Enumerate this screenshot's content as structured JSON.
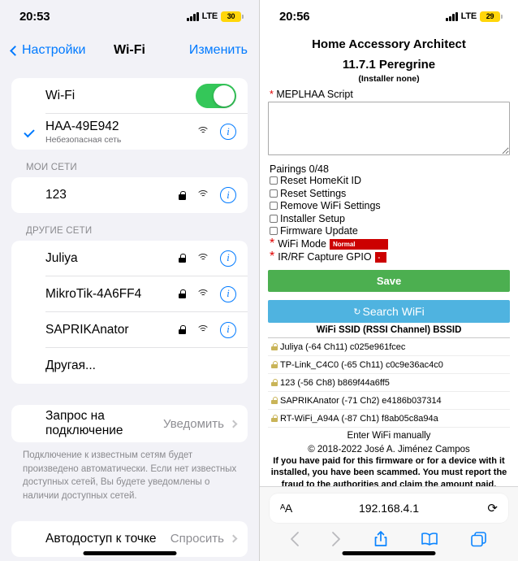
{
  "left": {
    "status": {
      "time": "20:53",
      "carrier": "LTE",
      "battery": "30"
    },
    "nav": {
      "back": "Настройки",
      "title": "Wi-Fi",
      "action": "Изменить"
    },
    "wifi_toggle_row": {
      "label": "Wi-Fi",
      "enabled": true
    },
    "connected": {
      "ssid": "HAA-49E942",
      "subtitle": "Небезопасная сеть",
      "info_icon": "i",
      "wifi_icon": "wifi-icon",
      "check_icon": "checkmark-icon"
    },
    "my_networks_header": "МОИ СЕТИ",
    "my_networks": [
      {
        "ssid": "123",
        "lock": "lock-icon",
        "wifi": "wifi-icon",
        "info": "i"
      }
    ],
    "other_networks_header": "ДРУГИЕ СЕТИ",
    "other_networks": [
      {
        "ssid": "Juliya",
        "lock": "lock-icon",
        "wifi": "wifi-icon",
        "info": "i"
      },
      {
        "ssid": "MikroTik-4A6FF4",
        "lock": "lock-icon",
        "wifi": "wifi-icon",
        "info": "i"
      },
      {
        "ssid": "SAPRIKAnator",
        "lock": "lock-icon",
        "wifi": "wifi-icon",
        "info": "i"
      }
    ],
    "other_row": "Другая...",
    "ask_to_join": {
      "label": "Запрос на подключение",
      "value": "Уведомить"
    },
    "ask_to_join_note": "Подключение к известным сетям будет произведено автоматически. Если нет известных доступных сетей, Вы будете уведомлены о наличии доступных сетей.",
    "auto_hotspot": {
      "label": "Автодоступ к точке",
      "value": "Спросить"
    }
  },
  "right": {
    "status": {
      "time": "20:56",
      "carrier": "LTE",
      "battery": "29"
    },
    "page": {
      "title_line1": "Home Accessory Architect",
      "title_line2": "11.7.1 Peregrine",
      "installer": "(Installer none)",
      "script_label": "MEPLHAA Script",
      "script_value": "",
      "pairings": "Pairings 0/48",
      "checkboxes": [
        {
          "label": "Reset HomeKit ID",
          "checked": false
        },
        {
          "label": "Reset Settings",
          "checked": false
        },
        {
          "label": "Remove WiFi Settings",
          "checked": false
        },
        {
          "label": "Installer Setup",
          "checked": false
        },
        {
          "label": "Firmware Update",
          "checked": false
        }
      ],
      "selects": [
        {
          "label": "WiFi Mode",
          "value": "Normal",
          "required": true
        },
        {
          "label": "IR/RF Capture GPIO",
          "value": "-",
          "required": true
        }
      ],
      "save_label": "Save",
      "search_label": "Search WiFi",
      "search_icon": "refresh-icon",
      "scan_header": "WiFi SSID (RSSI Channel) BSSID",
      "scan_results": [
        {
          "ssid": "Juliya",
          "rssi": "-64",
          "channel": "Ch11",
          "bssid": "c025e961fcec"
        },
        {
          "ssid": "TP-Link_C4C0",
          "rssi": "-65",
          "channel": "Ch11",
          "bssid": "c0c9e36ac4c0"
        },
        {
          "ssid": "123",
          "rssi": "-56",
          "channel": "Ch8",
          "bssid": "b869f44a6ff5"
        },
        {
          "ssid": "SAPRIKAnator",
          "rssi": "-71",
          "channel": "Ch2",
          "bssid": "e4186b037314"
        },
        {
          "ssid": "RT-WiFi_A94A",
          "rssi": "-87",
          "channel": "Ch1",
          "bssid": "f8ab05c8a94a"
        }
      ],
      "manual_link": "Enter WiFi manually",
      "copyright": "© 2018-2022 José A. Jiménez Campos",
      "warning": "If you have paid for this firmware or for a device with it installed, you have been scammed. You must report the fraud to the authorities and claim the amount paid."
    },
    "safari": {
      "text_size_label": "AA",
      "url": "192.168.4.1",
      "reload_icon": "reload-icon",
      "back_icon": "chevron-left-icon",
      "forward_icon": "chevron-right-icon",
      "share_icon": "share-icon",
      "bookmarks_icon": "book-icon",
      "tabs_icon": "tabs-icon"
    }
  },
  "colors": {
    "ios_blue": "#007AFF",
    "ios_green": "#34C759",
    "save_green": "#4CAF50",
    "search_blue": "#4FB3E0",
    "select_red": "#CC0000",
    "battery_yellow": "#FFD60A"
  }
}
